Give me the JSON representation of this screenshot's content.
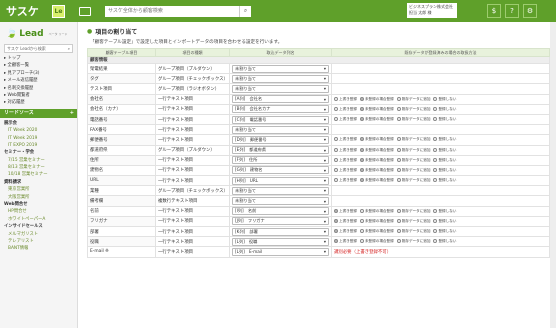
{
  "header": {
    "logo": "サスケ",
    "app_badge": "Le",
    "search_placeholder": "サスケ全体から顧客検索",
    "search_icon": "search-icon",
    "user": {
      "company": "株式会社サスケ",
      "name": "営業 太郎 様",
      "line1": "ビジネスプラン株式会社",
      "line2": "担当 太郎 様"
    },
    "buttons": [
      "$",
      "?",
      "⚙"
    ]
  },
  "sidebar": {
    "logo": "Lead",
    "logo_sub": "ベータ\nリード",
    "search_placeholder": "サスケ Leadから検索",
    "top_items": [
      "▸ トップ",
      "▸ 全顧客一覧",
      "▸ 見アプローチ(3)",
      "▸ メール返信履歴",
      "▸ 名刺交換履歴",
      "▸ Web閲覧者",
      "▸ 対応履歴"
    ],
    "lead_source_label": "リードソース",
    "lead_sections": [
      {
        "title": "展示会",
        "items": [
          "IT Week 2020",
          "IT Week 2019",
          "IT EXPO 2019"
        ]
      },
      {
        "title": "セミナー・学会",
        "items": [
          "7/15 営業セミナー",
          "8/13 営業セミナー",
          "10/18 営業セミナー"
        ]
      },
      {
        "title": "資料請求",
        "items": [
          "東京営業所",
          "大阪営業所"
        ]
      },
      {
        "title": "Web問合せ",
        "items": [
          "HP問合せ",
          "ホワイトペーパーA"
        ]
      },
      {
        "title": "インサイドセールス",
        "items": [
          "メルマガリスト",
          "テレアリスト",
          "BANT情報"
        ]
      }
    ]
  },
  "main": {
    "title": "項目の割り当て",
    "description": "「顧客テーブル設定」で設定した項目とインポートデータの項目を合わせる設定を行います。",
    "columns": [
      "顧客テーブル項目",
      "項目の種類",
      "取込データ列名",
      "既存データが登録済みの場合の取扱方法"
    ],
    "section_label": "顧客情報",
    "radio_labels": [
      "上書き登録",
      "未登録の場合登録",
      "既存データに追加",
      "登録しない"
    ],
    "rows": [
      {
        "name": "架電結果",
        "type": "グループ項目（プルダウン）",
        "value": "未割り当て",
        "radio": null
      },
      {
        "name": "タグ",
        "type": "グループ項目（チェックボックス）",
        "value": "未割り当て",
        "radio": null
      },
      {
        "name": "テスト項目",
        "type": "グループ項目（ラジオボタン）",
        "value": "未割り当て",
        "radio": null
      },
      {
        "name": "会社名",
        "type": "一行テキスト項目",
        "value": "[A列]　会社名",
        "radio": 1
      },
      {
        "name": "会社名（カナ）",
        "type": "一行テキスト項目",
        "value": "[B列]　会社名カナ",
        "radio": 1
      },
      {
        "name": "電話番号",
        "type": "一行テキスト項目",
        "value": "[C列]　電話番号",
        "radio": 1
      },
      {
        "name": "FAX番号",
        "type": "一行テキスト項目",
        "value": "未割り当て",
        "radio": null
      },
      {
        "name": "郵便番号",
        "type": "一行テキスト項目",
        "value": "[D列]　郵便番号",
        "radio": 1
      },
      {
        "name": "都道府県",
        "type": "グループ項目（プルダウン）",
        "value": "[E列]　都道府県",
        "radio": 1
      },
      {
        "name": "住所",
        "type": "一行テキスト項目",
        "value": "[F列]　住所",
        "radio": 1
      },
      {
        "name": "建物名",
        "type": "一行テキスト項目",
        "value": "[G列]　建物名",
        "radio": 1
      },
      {
        "name": "URL",
        "type": "一行テキスト項目",
        "value": "[H列]　URL",
        "radio": 1
      },
      {
        "name": "業種",
        "type": "グループ項目（チェックボックス）",
        "value": "未割り当て",
        "radio": null
      },
      {
        "name": "備考欄",
        "type": "複数行テキスト項目",
        "value": "未割り当て",
        "radio": null
      },
      {
        "name": "名前",
        "type": "一行テキスト項目",
        "value": "[I列]　名前",
        "radio": 0
      },
      {
        "name": "フリガナ",
        "type": "一行テキスト項目",
        "value": "[J列]　フリガナ",
        "radio": 0
      },
      {
        "name": "部署",
        "type": "一行テキスト項目",
        "value": "[K列]　部署",
        "radio": 0
      },
      {
        "name": "役職",
        "type": "一行テキスト項目",
        "value": "[L列]　役職",
        "radio": 0
      },
      {
        "name": "E-mail ※",
        "type": "一行テキスト項目",
        "value": "[L列]　E-mail",
        "radio": null,
        "warning": "識別必要（上書き登録不可）"
      }
    ]
  },
  "colors": {
    "accent": "#5fa02a",
    "header_bg": "#5fa02a",
    "warning": "#d42020"
  }
}
